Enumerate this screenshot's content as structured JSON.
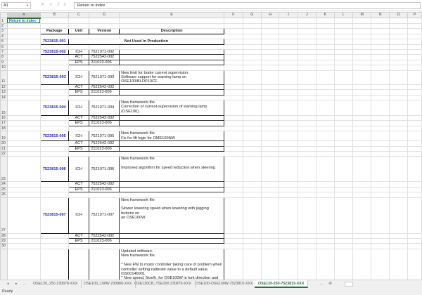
{
  "formula_bar": {
    "name_box": "A1",
    "formula": "Return to index",
    "icons": [
      "cancel-icon",
      "enter-icon",
      "function-icon"
    ]
  },
  "columns": [
    "A",
    "B",
    "C",
    "D",
    "E",
    "F",
    "G",
    "H",
    "I",
    "J",
    "K",
    "L",
    "M",
    "N",
    "O",
    "P"
  ],
  "cells": {
    "A1": "Return to index"
  },
  "table_header": {
    "package": "Package",
    "unit": "Unit",
    "version": "Version",
    "description": "Description"
  },
  "unused": {
    "package": "7523815-001",
    "note": "Not Used in Production"
  },
  "packages": [
    {
      "id": "7523815-002",
      "rows": [
        {
          "unit": "ICH",
          "version": "7521071-002",
          "desc": ""
        },
        {
          "unit": "ACT",
          "version": "7522542-002",
          "desc": ""
        },
        {
          "unit": "EPS",
          "version": "211023-006",
          "desc": ""
        }
      ]
    },
    {
      "id": "7523815-003",
      "rows": [
        {
          "unit": "ICH",
          "version": "7521071-003",
          "desc": "New limit for brake current supervision.\nSoftware support for warning lamp on OSE100/BLOP10CF."
        },
        {
          "unit": "ACT",
          "version": "7522542-002",
          "desc": ""
        },
        {
          "unit": "EPS",
          "version": "211023-006",
          "desc": ""
        }
      ]
    },
    {
      "id": "7523815-004",
      "rows": [
        {
          "unit": "ICH",
          "version": "7521071-004",
          "desc": "New framework file.\nCorrection of current-supervision of warning lamp (OSE100)."
        },
        {
          "unit": "ACT",
          "version": "7522542-002",
          "desc": ""
        },
        {
          "unit": "EPS",
          "version": "211023-006",
          "desc": ""
        }
      ]
    },
    {
      "id": "7523815-005",
      "rows": [
        {
          "unit": "ICH",
          "version": "7521071-005",
          "desc": "New framework file.\nFix for lift logic for OME100NW"
        },
        {
          "unit": "ACT",
          "version": "7522542-002",
          "desc": ""
        },
        {
          "unit": "EPS",
          "version": "211023-006",
          "desc": ""
        }
      ]
    },
    {
      "id": "7523815-006",
      "rows": [
        {
          "unit": "ICH",
          "version": "7521071-006",
          "desc": "New framework file\n\nImproved algorithm for speed reduction when steering"
        },
        {
          "unit": "ACT",
          "version": "7522542-002",
          "desc": ""
        },
        {
          "unit": "EPS",
          "version": "211023-006",
          "desc": ""
        }
      ]
    },
    {
      "id": "7523815-007",
      "rows": [
        {
          "unit": "ICH",
          "version": "7521071-007",
          "desc": "New framework file\n\nSlower lowering speed when lowering with jogging buttons on\nan OSE100W."
        },
        {
          "unit": "ACT",
          "version": "7522542-002",
          "desc": ""
        },
        {
          "unit": "EPS",
          "version": "211023-006",
          "desc": ""
        }
      ]
    },
    {
      "id": "",
      "rows": [
        {
          "unit": "",
          "version": "",
          "desc": "Updated software.\nNew framework file.\n\n* New FW to motor controller taking care of problem when\ncontroller setting calibrate value to a default value.\nISS00146901\n* New speed, 5km/h, for OSE100W in fork direction and man-"
        }
      ]
    }
  ],
  "sheet_tabs": [
    {
      "label": "OSE120_250 230878-XXX",
      "active": false
    },
    {
      "label": "OSE100_100W 230880-XXX",
      "active": false
    },
    {
      "label": "OSE120CB_TSE300 230879-XXX",
      "active": false
    },
    {
      "label": "OSE100-OSE100W-7523815-XXX",
      "active": false
    },
    {
      "label": "OSE120-250-7523815-XXX",
      "active": true
    }
  ],
  "tab_nav": {
    "prev": "◂",
    "next": "▸",
    "more": "...",
    "more_right": "...",
    "add": "⊕"
  },
  "status": "Ready",
  "colors": {
    "accent": "#217346",
    "link": "#1f1fd6"
  }
}
